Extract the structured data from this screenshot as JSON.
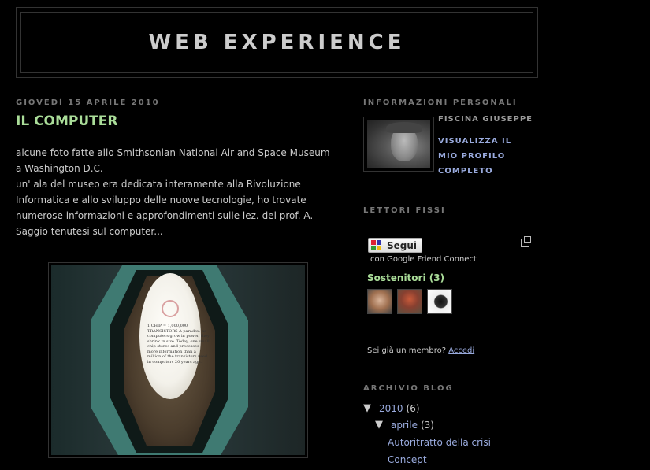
{
  "blog": {
    "title": "WEB EXPERIENCE"
  },
  "post": {
    "date": "GIOVEDÌ 15 APRILE 2010",
    "title": "IL COMPUTER",
    "paragraphs": [
      "alcune foto fatte allo Smithsonian National Air and Space Museum a Washington D.C.",
      "un' ala del museo era dedicata interamente alla Rivoluzione Informatica e allo sviluppo delle nuove tecnologie, ho trovate numerose informazioni e approfondimenti sulle lez. del prof. A. Saggio tenutesi sul computer..."
    ],
    "photo_text": "1 CHIP = 1,000,000 TRANSISTORS A paradox: as computers grow in power, they shrink in size. Today, one small chip stores and processes more information than a million of the transistors used in computers 20 years ago."
  },
  "sidebar": {
    "profile": {
      "heading": "INFORMAZIONI PERSONALI",
      "name": "FISCINA GIUSEPPE",
      "link": "VISUALIZZA IL MIO PROFILO COMPLETO"
    },
    "followers": {
      "heading": "LETTORI FISSI",
      "follow_button": "Segui",
      "gfc": "con Google Friend Connect",
      "supporters": "Sostenitori (3)",
      "member_prompt": "Sei già un membro?",
      "login": "Accedi"
    },
    "archive": {
      "heading": "ARCHIVIO BLOG",
      "year": "2010",
      "year_count": "(6)",
      "month": "aprile",
      "month_count": "(3)",
      "posts": [
        "Autoritratto della crisi",
        "Concept"
      ]
    }
  }
}
